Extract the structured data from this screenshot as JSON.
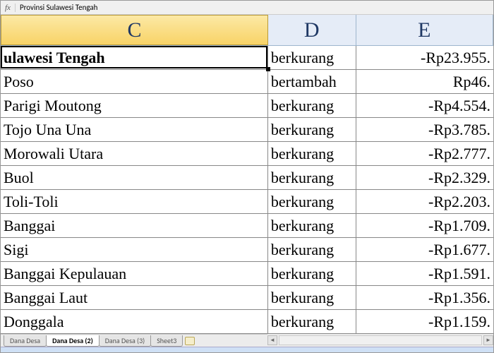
{
  "formula_bar": {
    "fx": "fx",
    "value": "Provinsi Sulawesi Tengah"
  },
  "columns": {
    "c": "C",
    "d": "D",
    "e": "E"
  },
  "rows": [
    {
      "c": "ulawesi Tengah",
      "d": "berkurang",
      "e": "-Rp23.955."
    },
    {
      "c": "Poso",
      "d": "bertambah",
      "e": "Rp46."
    },
    {
      "c": "Parigi Moutong",
      "d": "berkurang",
      "e": "-Rp4.554."
    },
    {
      "c": "Tojo Una Una",
      "d": "berkurang",
      "e": "-Rp3.785."
    },
    {
      "c": "Morowali Utara",
      "d": "berkurang",
      "e": "-Rp2.777."
    },
    {
      "c": "Buol",
      "d": "berkurang",
      "e": "-Rp2.329."
    },
    {
      "c": "Toli-Toli",
      "d": "berkurang",
      "e": "-Rp2.203."
    },
    {
      "c": "Banggai",
      "d": "berkurang",
      "e": "-Rp1.709."
    },
    {
      "c": "Sigi",
      "d": "berkurang",
      "e": "-Rp1.677."
    },
    {
      "c": "Banggai Kepulauan",
      "d": "berkurang",
      "e": "-Rp1.591."
    },
    {
      "c": "Banggai Laut",
      "d": "berkurang",
      "e": "-Rp1.356."
    },
    {
      "c": "Donggala",
      "d": "berkurang",
      "e": "-Rp1.159."
    }
  ],
  "tabs": {
    "t1": "Dana Desa",
    "t2": "Dana Desa (2)",
    "t3": "Dana Desa (3)",
    "t4": "Sheet3"
  }
}
